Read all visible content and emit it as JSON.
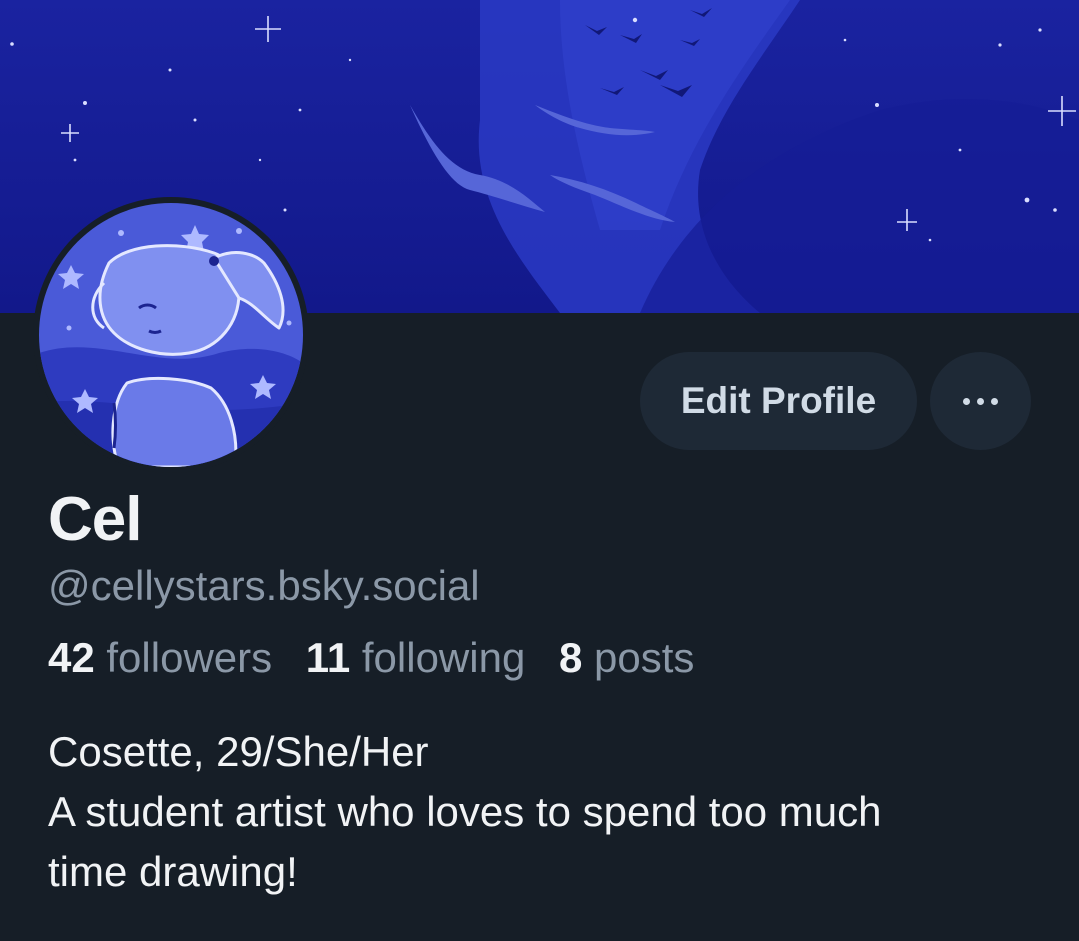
{
  "profile": {
    "display_name": "Cel",
    "handle": "@cellystars.bsky.social",
    "followers": {
      "count": "42",
      "label": "followers"
    },
    "following": {
      "count": "11",
      "label": "following"
    },
    "posts": {
      "count": "8",
      "label": "posts"
    },
    "bio_lines": [
      "Cosette, 29/She/Her",
      "A student artist who loves to spend too much",
      "time drawing!"
    ]
  },
  "actions": {
    "edit_profile_label": "Edit Profile",
    "more_icon": "ellipsis-icon"
  },
  "colors": {
    "background": "#161e27",
    "button_bg": "#1e2936",
    "banner_sky": "#141c8c",
    "avatar_bg": "#4a5ad8"
  }
}
